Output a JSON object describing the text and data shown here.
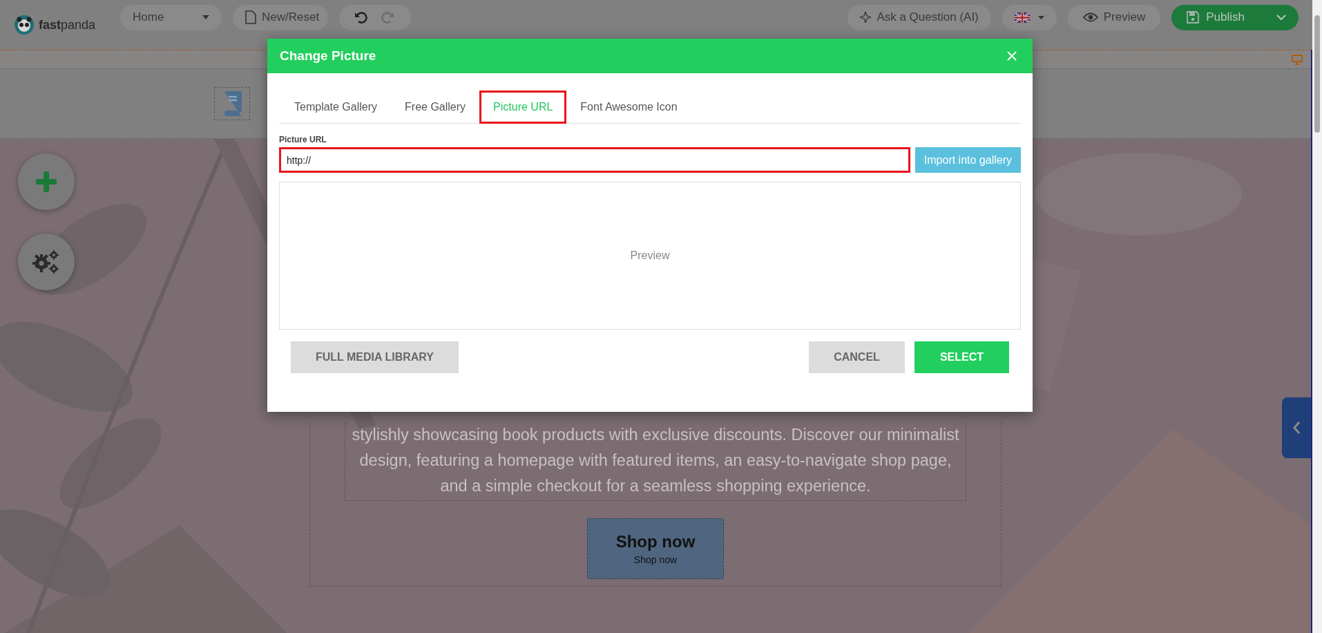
{
  "topbar": {
    "logo": "**fast**panda",
    "page_select": "Home",
    "new_reset": "New/Reset",
    "ai_button": "Ask a Question (AI)",
    "preview": "Preview",
    "publish": "Publish"
  },
  "hero": {
    "paragraph": "stylishly showcasing book products with exclusive discounts. Discover our minimalist design, featuring a homepage with featured items, an easy-to-navigate shop page, and a simple checkout for a seamless shopping experience.",
    "cta_title": "Shop now",
    "cta_subtitle": "Shop now"
  },
  "dialog": {
    "title": "Change Picture",
    "tabs": [
      {
        "label": "Template Gallery",
        "selected": false
      },
      {
        "label": "Free Gallery",
        "selected": false
      },
      {
        "label": "Picture URL",
        "selected": true
      },
      {
        "label": "Font Awesome Icon",
        "selected": false
      }
    ],
    "url_field": {
      "label": "Picture URL",
      "value": "http://",
      "highlighted": true
    },
    "import_button": "Import into gallery",
    "preview_label": "Preview",
    "library_button": "FULL MEDIA LIBRARY",
    "cancel_button": "CANCEL",
    "select_button": "SELECT"
  }
}
